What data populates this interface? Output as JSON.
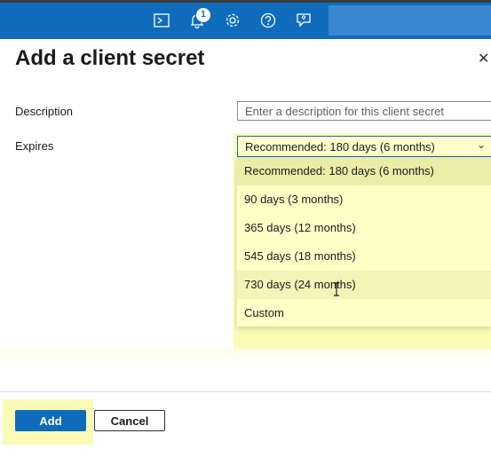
{
  "topbar": {
    "icons": [
      "cloud-shell-icon",
      "notifications-icon",
      "settings-icon",
      "help-icon",
      "feedback-icon"
    ],
    "notification_count": "1",
    "color": "#0f6cbd"
  },
  "panel": {
    "title": "Add a client secret",
    "close_label": "✕"
  },
  "form": {
    "description_label": "Description",
    "description_placeholder": "Enter a description for this client secret",
    "expires_label": "Expires",
    "expires_value": "Recommended: 180 days (6 months)",
    "options": [
      "Recommended: 180 days (6 months)",
      "90 days (3 months)",
      "365 days (12 months)",
      "545 days (18 months)",
      "730 days (24 months)",
      "Custom"
    ]
  },
  "footer": {
    "add_label": "Add",
    "cancel_label": "Cancel"
  }
}
